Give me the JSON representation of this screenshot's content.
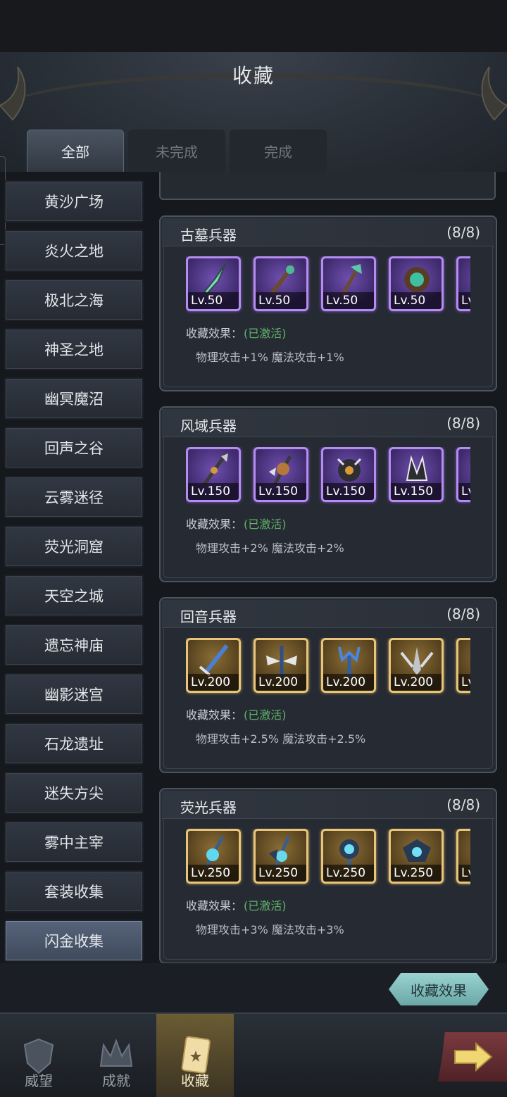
{
  "screen": {
    "title": "收藏",
    "tabs": [
      {
        "label": "全部",
        "active": true
      },
      {
        "label": "未完成",
        "active": false
      },
      {
        "label": "完成",
        "active": false
      }
    ],
    "sidebar": [
      {
        "label": "黄沙广场"
      },
      {
        "label": "炎火之地"
      },
      {
        "label": "极北之海"
      },
      {
        "label": "神圣之地"
      },
      {
        "label": "幽冥魔沼"
      },
      {
        "label": "回声之谷"
      },
      {
        "label": "云雾迷径"
      },
      {
        "label": "荧光洞窟"
      },
      {
        "label": "天空之城"
      },
      {
        "label": "遗忘神庙"
      },
      {
        "label": "幽影迷宫"
      },
      {
        "label": "石龙遗址"
      },
      {
        "label": "迷失方尖"
      },
      {
        "label": "雾中主宰"
      },
      {
        "label": "套装收集"
      },
      {
        "label": "闪金收集",
        "active": true
      }
    ],
    "collections": [
      {
        "name": "古墓兵器",
        "count": "(8/8)",
        "rarity": "purple",
        "levels": [
          "Lv.50",
          "Lv.50",
          "Lv.50",
          "Lv.50",
          "Lv"
        ],
        "effect_label": "收藏效果：",
        "effect_state": "(已激活)",
        "effect_text": "物理攻击+1%  魔法攻击+1%"
      },
      {
        "name": "风域兵器",
        "count": "(8/8)",
        "rarity": "purple",
        "levels": [
          "Lv.150",
          "Lv.150",
          "Lv.150",
          "Lv.150",
          "Lv"
        ],
        "effect_label": "收藏效果：",
        "effect_state": "(已激活)",
        "effect_text": "物理攻击+2%  魔法攻击+2%"
      },
      {
        "name": "回音兵器",
        "count": "(8/8)",
        "rarity": "gold",
        "levels": [
          "Lv.200",
          "Lv.200",
          "Lv.200",
          "Lv.200",
          "Lv"
        ],
        "effect_label": "收藏效果：",
        "effect_state": "(已激活)",
        "effect_text": "物理攻击+2.5%  魔法攻击+2.5%"
      },
      {
        "name": "荧光兵器",
        "count": "(8/8)",
        "rarity": "gold",
        "levels": [
          "Lv.250",
          "Lv.250",
          "Lv.250",
          "Lv.250",
          "Lv"
        ],
        "effect_label": "收藏效果：",
        "effect_state": "(已激活)",
        "effect_text": "物理攻击+3%  魔法攻击+3%"
      }
    ],
    "effect_button": "收藏效果",
    "nav": [
      {
        "label": "威望",
        "icon": "shield-icon"
      },
      {
        "label": "成就",
        "icon": "crown-icon"
      },
      {
        "label": "收藏",
        "icon": "card-icon",
        "active": true
      }
    ],
    "colors": {
      "active_green": "#5fb26a",
      "gold_frame": "#e8c57a",
      "purple_frame": "#b58cf0",
      "teal_button": "#9ad3d0"
    }
  }
}
